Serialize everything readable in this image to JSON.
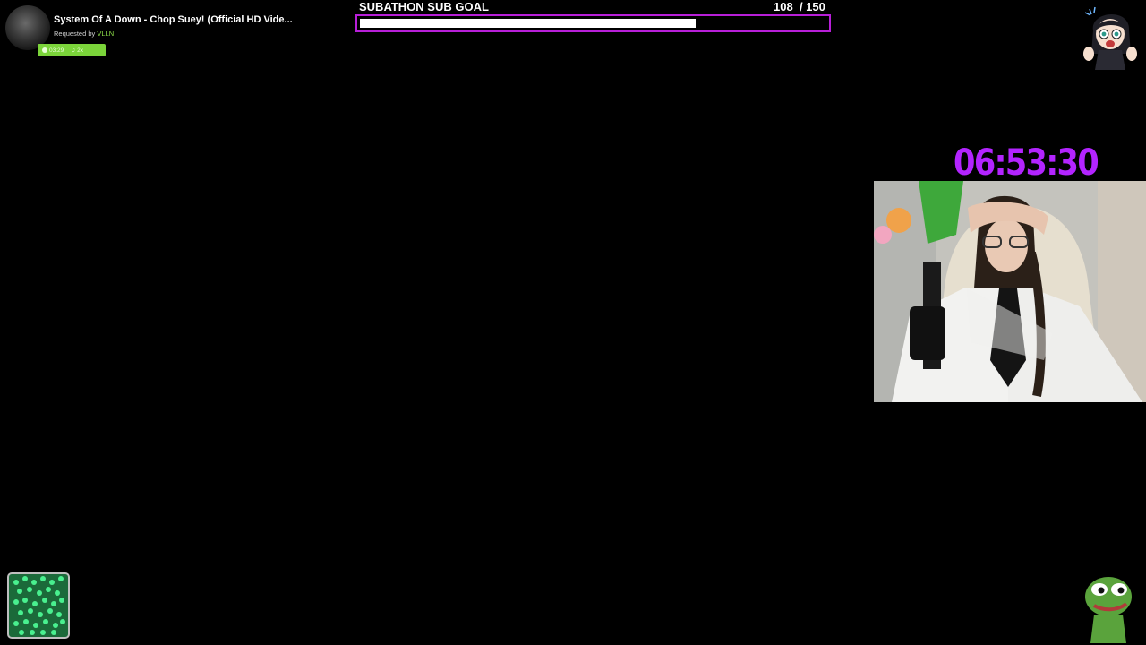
{
  "now_playing": {
    "title": "System Of A Down - Chop Suey! (Official HD Vide...",
    "requested_prefix": "Requested by",
    "requested_user": "VLLN",
    "duration": "03:29",
    "queue_label": "2x"
  },
  "sub_goal": {
    "label": "SUBATHON SUB GOAL",
    "current": 108,
    "target": 150,
    "current_text": "108",
    "target_text": "/ 150"
  },
  "countdown": {
    "time": "06:53:30"
  },
  "icons": {
    "album_art": "album-art",
    "clock": "clock-icon",
    "music": "music-note-icon",
    "webcam": "webcam-feed",
    "jar": "sub-jar-icon",
    "pepe": "pepe-emote-icon",
    "avatar": "streamer-avatar-icon"
  },
  "colors": {
    "background": "#000000",
    "goal_border": "#b81fd8",
    "goal_fill": "#ffffff",
    "countdown": "#b324ff",
    "badge": "#7bd43a",
    "requested_user": "#8fe24a"
  }
}
